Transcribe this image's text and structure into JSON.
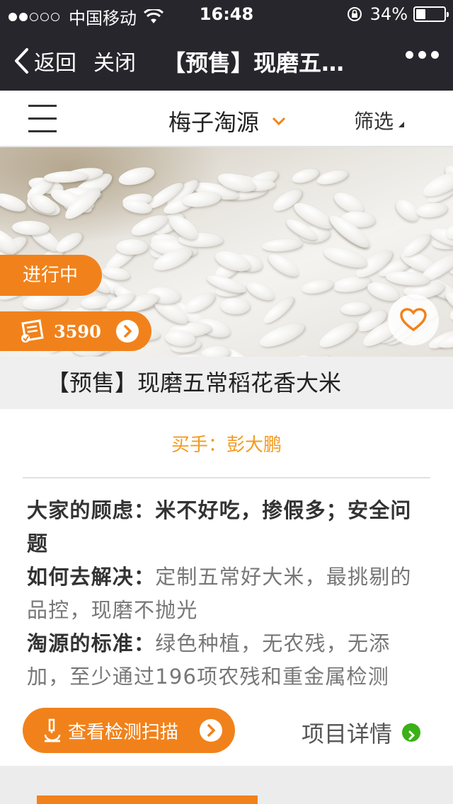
{
  "status_bar": {
    "carrier": "中国移动",
    "time": "16:48",
    "battery_percent": "34%",
    "battery_level": 0.34,
    "signal_bars": 2
  },
  "nav": {
    "back_label": "返回",
    "close_label": "关闭",
    "title": "【预售】现磨五…"
  },
  "filter_bar": {
    "source_name": "梅子淘源",
    "filter_label": "筛选"
  },
  "hero": {
    "status_tag": "进行中",
    "count": "3590"
  },
  "product": {
    "title": "【预售】现磨五常稻花香大米",
    "buyer": "买手：彭大鹏",
    "concern_label": "大家的顾虑：",
    "concern_text": "米不好吃，掺假多；安全问题",
    "solution_label": "如何去解决：",
    "solution_text": "定制五常好大米，最挑剔的品控，现磨不抛光",
    "standard_label": "淘源的标准：",
    "standard_text": "绿色种植，无农残，无添加，至少通过196项农残和重金属检测"
  },
  "actions": {
    "scan_label": "查看检测扫描",
    "detail_label": "项目详情"
  },
  "colors": {
    "accent": "#f1821b",
    "buyer_text": "#f39a1f",
    "nav_bg": "#26262c",
    "green": "#3bb017"
  }
}
